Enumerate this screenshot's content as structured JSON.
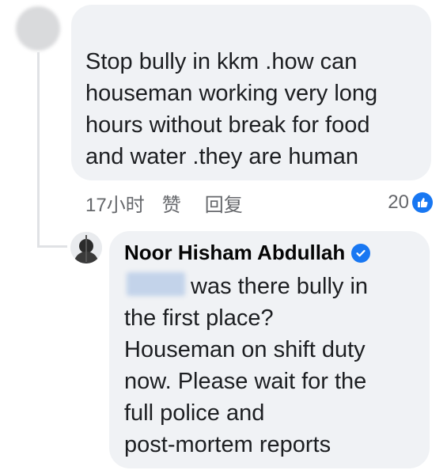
{
  "comment": {
    "lines": [
      "Stop bully in kkm .how can",
      "houseman working very long",
      "hours without break for food",
      "and water .they are human"
    ],
    "time": "17小时",
    "like_label": "赞",
    "reply_label": "回复",
    "reaction_count": "20"
  },
  "reply": {
    "author": "Noor Hisham Abdullah",
    "lines": [
      "was there bully in",
      "the first place?",
      "Houseman on shift duty",
      "now. Please wait for the",
      "full police and",
      "post-mortem reports"
    ]
  },
  "colors": {
    "bubble": "#f0f2f5",
    "text": "#1c1e21",
    "secondary": "#65676b",
    "accent": "#1877f2"
  }
}
